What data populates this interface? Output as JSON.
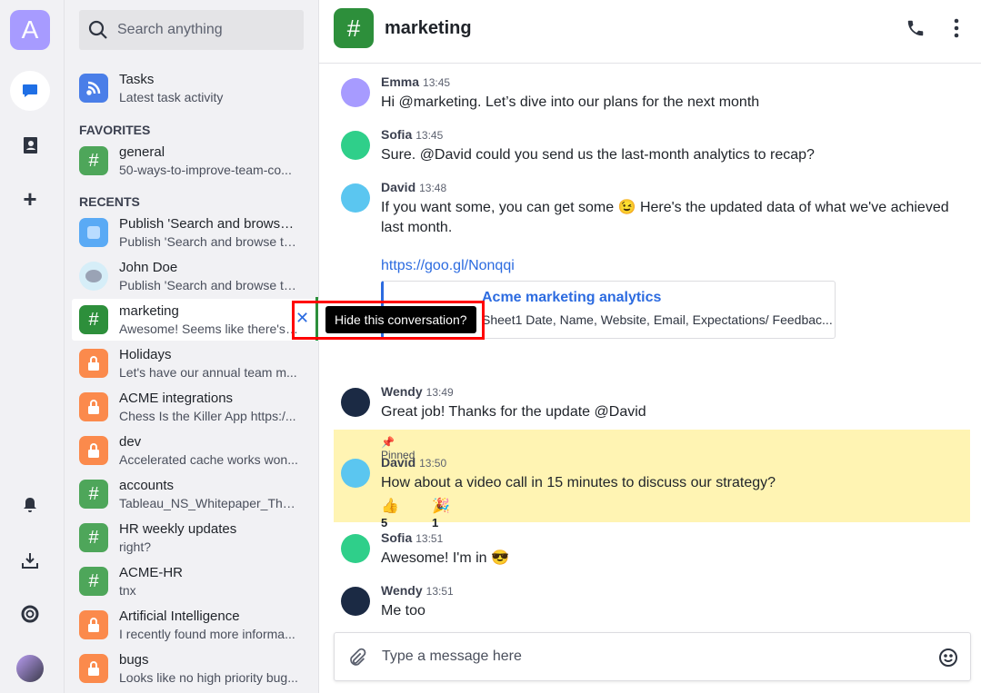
{
  "rail": {
    "logo": "A",
    "icons": [
      "chat-icon",
      "contacts-icon",
      "plus-icon",
      "bell-icon",
      "download-icon",
      "help-icon",
      "user-avatar"
    ]
  },
  "search": {
    "placeholder": "Search anything"
  },
  "tasks": {
    "title": "Tasks",
    "subtitle": "Latest task activity"
  },
  "favorites": {
    "label": "FAVORITES",
    "items": [
      {
        "title": "general",
        "subtitle": "50-ways-to-improve-team-co..."
      }
    ]
  },
  "recents": {
    "label": "RECENTS",
    "items": [
      {
        "title": "Publish 'Search and browse ...",
        "subtitle": "Publish 'Search and browse ta...",
        "type": "task"
      },
      {
        "title": "John Doe",
        "subtitle": "Publish 'Search and browse ta...",
        "type": "bot"
      },
      {
        "title": "marketing",
        "subtitle": "Awesome! Seems like there's ...",
        "type": "channel"
      },
      {
        "title": "Holidays",
        "subtitle": "Let's have our annual team m...",
        "type": "private"
      },
      {
        "title": "ACME integrations",
        "subtitle": "Chess Is the Killer App https:/...",
        "type": "private"
      },
      {
        "title": "dev",
        "subtitle": "Accelerated cache works won...",
        "type": "private"
      },
      {
        "title": "accounts",
        "subtitle": "Tableau_NS_Whitepaper_The_...",
        "type": "channel"
      },
      {
        "title": "HR weekly updates",
        "subtitle": "right?",
        "type": "channel"
      },
      {
        "title": "ACME-HR",
        "subtitle": "tnx",
        "type": "channel"
      },
      {
        "title": "Artificial Intelligence",
        "subtitle": "I recently found more informa...",
        "type": "private"
      },
      {
        "title": "bugs",
        "subtitle": "Looks like no high priority bug...",
        "type": "private"
      }
    ]
  },
  "tooltip": "Hide this conversation?",
  "header": {
    "title": "marketing"
  },
  "messages": [
    {
      "name": "Emma",
      "time": "13:45",
      "text": "Hi @marketing. Let’s dive into our plans for the next month"
    },
    {
      "name": "Sofia",
      "time": "13:45",
      "text": "Sure. @David could you send us the last-month analytics to recap?"
    },
    {
      "name": "David",
      "time": "13:48",
      "text": "If you want some, you can get some 😉 Here's the updated data of what we've achieved",
      "text2": "last month.",
      "link": "https://goo.gl/Nonqqi",
      "preview_title": "Acme marketing analytics",
      "preview_desc": "Sheet1 Date, Name, Website, Email, Expectations/ Feedbac..."
    },
    {
      "name": "Wendy",
      "time": "13:49",
      "text": "Great job! Thanks for the update @David"
    },
    {
      "name": "David",
      "time": "13:50",
      "pinned": "Pinned",
      "text": "How about a video call in 15 minutes to discuss our strategy?",
      "reactions": [
        {
          "emoji": "👍",
          "count": "5"
        },
        {
          "emoji": "🎉",
          "count": "1"
        }
      ]
    },
    {
      "name": "Sofia",
      "time": "13:51",
      "text": "Awesome! I'm in 😎"
    },
    {
      "name": "Wendy",
      "time": "13:51",
      "text": "Me too"
    }
  ],
  "composer": {
    "placeholder": "Type a message here"
  },
  "colors": {
    "channel": "#4ea65a",
    "private": "#fb8a4c",
    "tasks": "#4a7ee8",
    "active_channel": "#2d8f3b",
    "pinned_bg": "#fff4b3",
    "link": "#2c6be0"
  }
}
